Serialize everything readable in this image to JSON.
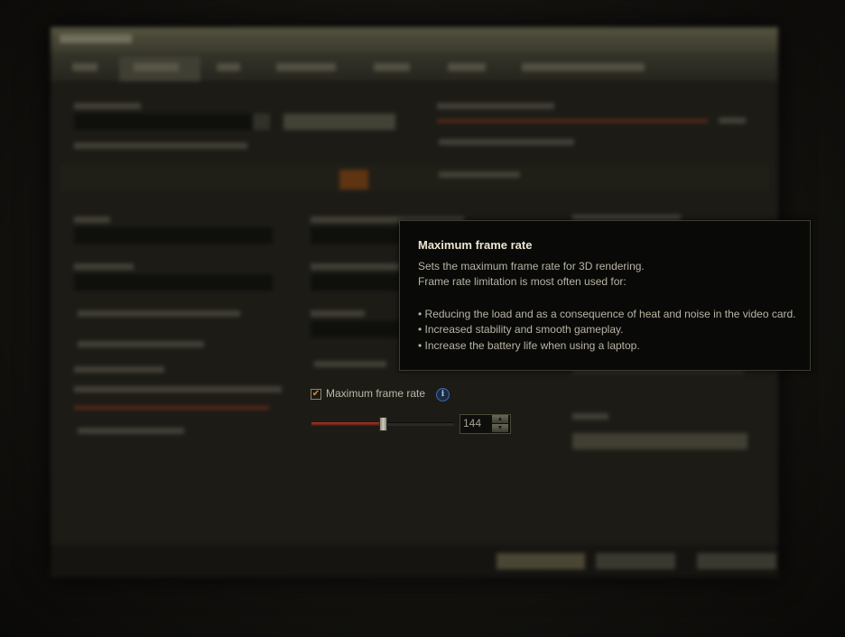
{
  "tooltip": {
    "title": "Maximum frame rate",
    "line1": "Sets the maximum frame rate for 3D rendering.",
    "line2": "Frame rate limitation is most often used for:",
    "bullets": [
      "• Reducing the load and as a consequence of heat and noise in the video card.",
      "• Increased stability and smooth gameplay.",
      "• Increase the battery life when using a laptop."
    ]
  },
  "frame_rate": {
    "label": "Maximum frame rate",
    "checked": true,
    "check_glyph": "✔",
    "info_glyph": "i",
    "value": "144",
    "slider_fraction": 0.5,
    "spin_up_glyph": "▲",
    "spin_down_glyph": "▼",
    "accent_color": "#a33a24"
  },
  "icons": {
    "info": "info-icon",
    "check": "check-icon",
    "spin_up": "chevron-up-icon",
    "spin_down": "chevron-down-icon"
  }
}
